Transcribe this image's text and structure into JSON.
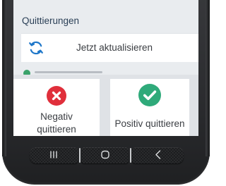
{
  "screen": {
    "section_header": "Quittierungen",
    "update_row": {
      "icon": "refresh-icon",
      "label": "Jetzt aktualisieren"
    },
    "buttons": {
      "negative": {
        "icon": "x-circle-icon",
        "label_line1": "Negativ",
        "label_line2": "quittieren",
        "color": "#e02f3b"
      },
      "positive": {
        "icon": "check-circle-icon",
        "label": "Positiv quittieren",
        "color": "#2faa7a"
      }
    }
  },
  "navigation": {
    "recent_icon": "recent-apps-icon",
    "home_icon": "home-icon",
    "back_icon": "back-icon"
  },
  "colors": {
    "accent_blue": "#1f77c9",
    "status_green": "#3aa26a",
    "device_body": "#2b2c2f"
  }
}
